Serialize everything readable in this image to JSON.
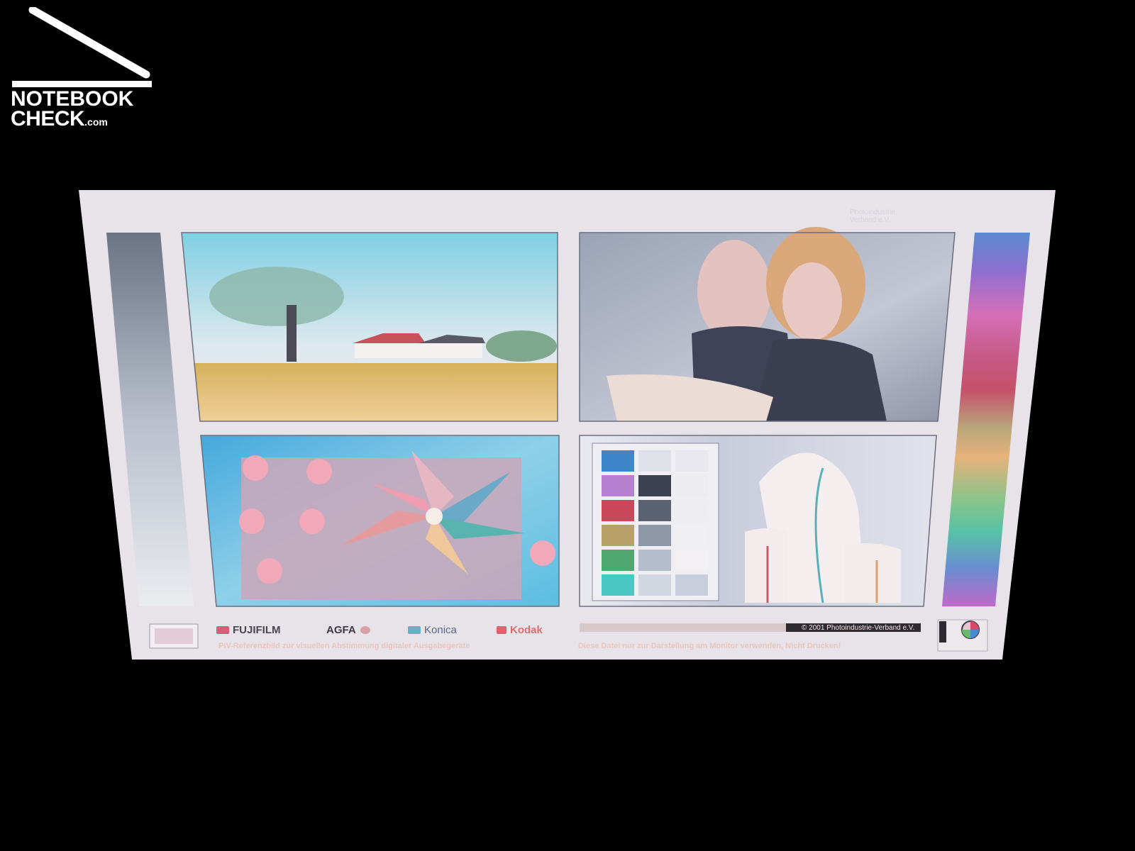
{
  "logo": {
    "line1": "NOTEBOOK",
    "line2": "CHECK",
    "domain": ".com"
  },
  "testchart": {
    "brands": [
      "FUJIFILM",
      "AGFA",
      "Konica",
      "Kodak"
    ],
    "caption_left": "PIV-Referenzbild zur visuellen Abstimmung digitaler Ausgabegeräte",
    "caption_right": "Diese Datei  nur zur Darstellung am Monitor verwenden, Nicht Drucken!",
    "copyright": "© 2001 Photoindustrie-Verband e.V.",
    "header_text": "Photoindustrie\nVerband e.V."
  },
  "colors": {
    "background": "#000000",
    "screen": "#e9e3ea",
    "sky": "#bfe0ea",
    "field": "#e7c27f",
    "pinwheel_bg": "#49b3d8",
    "portrait_bg": "#9aa3b6",
    "still_life_bg": "#cfd2e2"
  }
}
